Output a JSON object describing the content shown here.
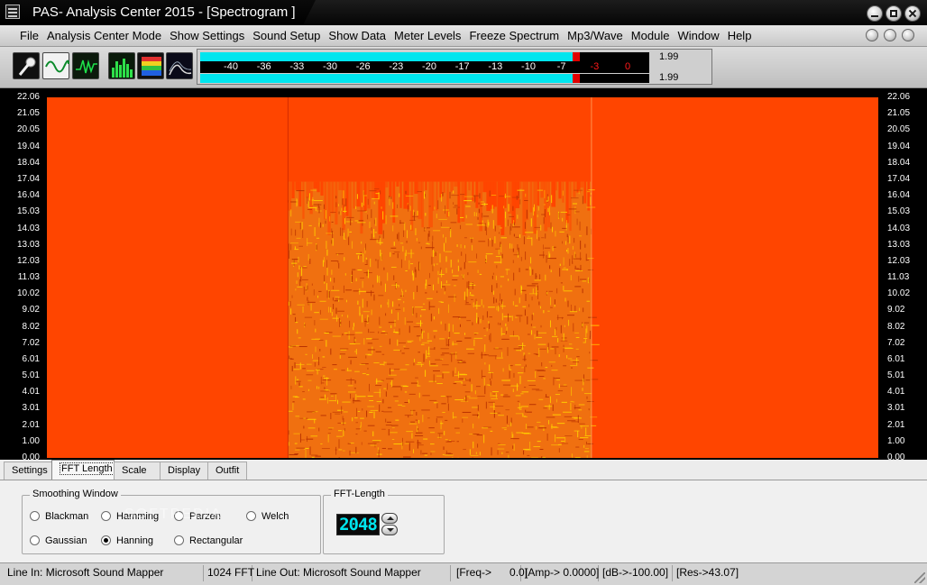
{
  "window": {
    "title": "PAS- Analysis Center 2015 - [Spectrogram ]"
  },
  "menu": {
    "items": [
      "File",
      "Analysis Center Mode",
      "Show Settings",
      "Sound Setup",
      "Show Data",
      "Meter Levels",
      "Freeze Spectrum",
      "Mp3/Wave",
      "Module",
      "Window",
      "Help"
    ]
  },
  "toolbar": {
    "tools": [
      {
        "icon": "microphone-icon"
      },
      {
        "icon": "sine-wave-icon"
      },
      {
        "icon": "oscilloscope-icon"
      },
      {
        "icon": "spectrum-analyzer-icon"
      },
      {
        "icon": "spectrogram-icon"
      },
      {
        "icon": "waterfall-icon"
      }
    ]
  },
  "level_meter": {
    "scale": [
      "-40",
      "-36",
      "-33",
      "-30",
      "-26",
      "-23",
      "-20",
      "-17",
      "-13",
      "-10",
      "-7",
      "-3",
      "0"
    ],
    "red_from": "-3",
    "channel_1": {
      "level_fraction": 0.83,
      "value": "1.99"
    },
    "channel_2": {
      "level_fraction": 0.83,
      "value": "1.99"
    },
    "colors": {
      "fill": "#00e5ee",
      "peak": "#e00000"
    }
  },
  "spectrogram": {
    "y_axis_kHz": [
      "22.06",
      "21.05",
      "20.05",
      "19.04",
      "18.04",
      "17.04",
      "16.04",
      "15.03",
      "14.03",
      "13.03",
      "12.03",
      "11.03",
      "10.02",
      "9.02",
      "8.02",
      "7.02",
      "6.01",
      "5.01",
      "4.01",
      "3.01",
      "2.01",
      "1.00",
      "0.00"
    ],
    "background_color": "#ff4500",
    "signal_color": "#ffd000",
    "signal_time_fraction": [
      0.29,
      0.655
    ],
    "signal_top_kHz": 16.9
  },
  "tabs": [
    {
      "label": "Settings",
      "active": false
    },
    {
      "label": "FFT Length",
      "active": true
    },
    {
      "label": "Scale",
      "active": false
    },
    {
      "label": "Display",
      "active": false
    },
    {
      "label": "Outfit",
      "active": false
    }
  ],
  "smoothing_window": {
    "title": "Smoothing Window",
    "options": [
      {
        "label": "Blackman",
        "checked": false
      },
      {
        "label": "Hamming",
        "checked": false
      },
      {
        "label": "Parzen",
        "checked": false
      },
      {
        "label": "Welch",
        "checked": false
      },
      {
        "label": "Gaussian",
        "checked": false
      },
      {
        "label": "Hanning",
        "checked": true
      },
      {
        "label": "Rectangular",
        "checked": false
      }
    ]
  },
  "fft_length": {
    "title": "FFT-Length",
    "value": "2048"
  },
  "watermark": "SOFTPEDIA",
  "status": {
    "line_in": "Line In: Microsoft Sound Mapper",
    "fft": "1024 FFT",
    "line_out": "Line Out: Microsoft Sound Mapper",
    "freq": "[Freq->      0.0]",
    "amp": "[Amp-> 0.0000]",
    "db": "[dB->-100.00]",
    "res": "[Res->43.07]"
  }
}
